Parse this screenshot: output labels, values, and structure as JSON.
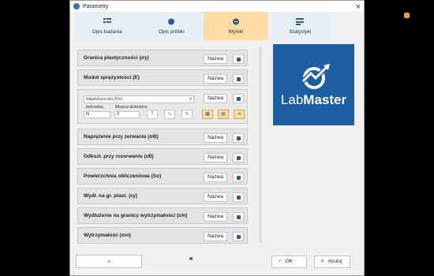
{
  "window": {
    "title": "Parametry"
  },
  "tabs": [
    {
      "label": "Opis badania",
      "active": false
    },
    {
      "label": "Opis próbki",
      "active": false
    },
    {
      "label": "Wyniki",
      "active": true
    },
    {
      "label": "Statystyki",
      "active": false
    }
  ],
  "rows": [
    {
      "label": "Granica plastyczności (σy)"
    },
    {
      "label": "Moduł sprężystości (E)"
    },
    {
      "label": "Naprężenie przy zerwaniu (σB)"
    },
    {
      "label": "Odkszt. przy rozerwaniu (εB)"
    },
    {
      "label": "Powierzchnia obliczeniowa (So)"
    },
    {
      "label": "Wydł. na gr. plast. (εy)"
    },
    {
      "label": "Wydłużenie na granicy wytrzymałości (εm)"
    },
    {
      "label": "Wytrzymałość (σm)"
    }
  ],
  "name_button_label": "Nazwa",
  "expanded": {
    "select_value": "Największa siła (Fm)",
    "unit_label": "Jednostka",
    "unit_value": "N",
    "decimals_label": "Miejsca dziesiętne",
    "decimals_value": "2",
    "name_button_label": "Nazwa"
  },
  "logo": {
    "brand_light": "Lab",
    "brand_bold": "Master"
  },
  "footer": {
    "add_label": "+",
    "ok_label": "OK",
    "cancel_label": "Anuluj"
  },
  "colors": {
    "accent": "#1d5ea3",
    "active_tab": "#ffdca3"
  }
}
